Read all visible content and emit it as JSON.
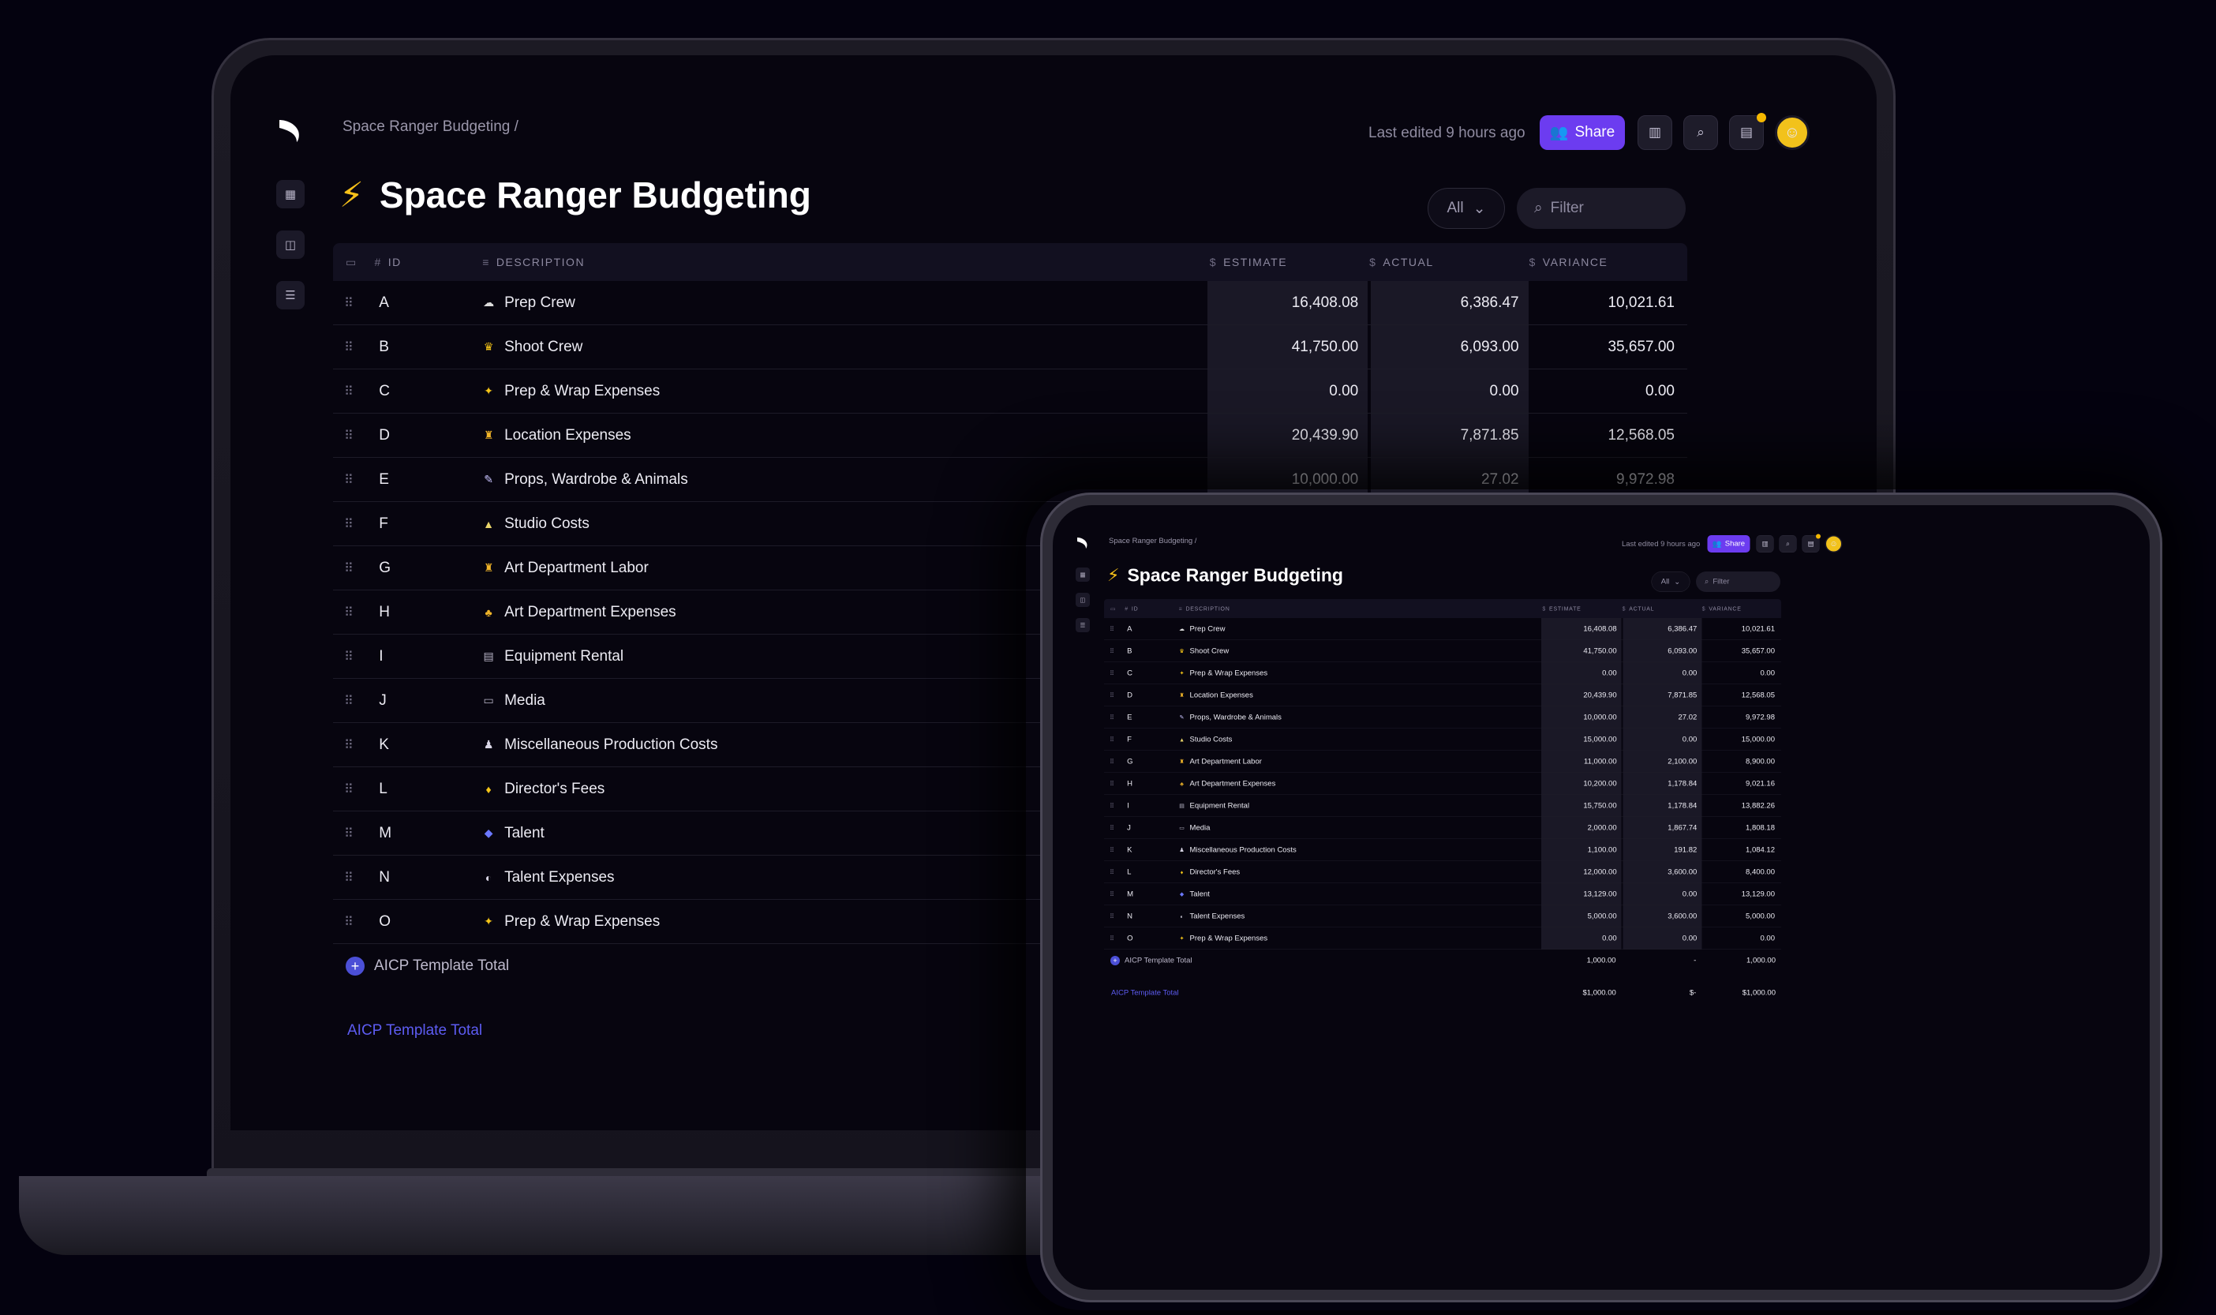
{
  "app": {
    "breadcrumb": "Space Ranger Budgeting /",
    "title": "Space Ranger Budgeting",
    "title_icon": "lightning-bolt",
    "last_edited": "Last edited 9 hours ago",
    "share_label": "Share",
    "filter_select": "All",
    "filter_placeholder": "Filter",
    "accent_color": "#6c3cf0"
  },
  "table": {
    "headers": {
      "id": "ID",
      "description": "DESCRIPTION",
      "estimate": "ESTIMATE",
      "actual": "ACTUAL",
      "variance": "VARIANCE"
    },
    "rows": [
      {
        "id": "A",
        "icon": "☁",
        "description": "Prep Crew",
        "estimate": "16,408.08",
        "actual": "6,386.47",
        "variance": "10,021.61"
      },
      {
        "id": "B",
        "icon": "♛",
        "description": "Shoot Crew",
        "estimate": "41,750.00",
        "actual": "6,093.00",
        "variance": "35,657.00"
      },
      {
        "id": "C",
        "icon": "✦",
        "description": "Prep & Wrap Expenses",
        "estimate": "0.00",
        "actual": "0.00",
        "variance": "0.00"
      },
      {
        "id": "D",
        "icon": "♜",
        "description": "Location Expenses",
        "estimate": "20,439.90",
        "actual": "7,871.85",
        "variance": "12,568.05"
      },
      {
        "id": "E",
        "icon": "✎",
        "description": "Props, Wardrobe & Animals",
        "estimate": "10,000.00",
        "actual": "27.02",
        "variance": "9,972.98"
      },
      {
        "id": "F",
        "icon": "▲",
        "description": "Studio Costs",
        "estimate": "15,000.00",
        "actual": "0.00",
        "variance": "15,000.00"
      },
      {
        "id": "G",
        "icon": "♜",
        "description": "Art Department Labor",
        "estimate": "11,000.00",
        "actual": "2,100.00",
        "variance": "8,900.00"
      },
      {
        "id": "H",
        "icon": "♣",
        "description": "Art Department Expenses",
        "estimate": "10,200.00",
        "actual": "1,178.84",
        "variance": "9,021.16"
      },
      {
        "id": "I",
        "icon": "▤",
        "description": "Equipment Rental",
        "estimate": "15,750.00",
        "actual": "1,178.84",
        "variance": "13,882.26"
      },
      {
        "id": "J",
        "icon": "▭",
        "description": "Media",
        "estimate": "2,000.00",
        "actual": "1,867.74",
        "variance": "1,808.18"
      },
      {
        "id": "K",
        "icon": "♟",
        "description": "Miscellaneous Production Costs",
        "estimate": "1,100.00",
        "actual": "191.82",
        "variance": "1,084.12"
      },
      {
        "id": "L",
        "icon": "♦",
        "description": "Director's Fees",
        "estimate": "12,000.00",
        "actual": "3,600.00",
        "variance": "8,400.00"
      },
      {
        "id": "M",
        "icon": "◆",
        "description": "Talent",
        "estimate": "13,129.00",
        "actual": "0.00",
        "variance": "13,129.00"
      },
      {
        "id": "N",
        "icon": "◐",
        "description": "Talent Expenses",
        "estimate": "5,000.00",
        "actual": "3,600.00",
        "variance": "5,000.00"
      },
      {
        "id": "O",
        "icon": "✦",
        "description": "Prep & Wrap Expenses",
        "estimate": "0.00",
        "actual": "0.00",
        "variance": "0.00"
      }
    ],
    "template_total": {
      "label": "AICP Template Total",
      "estimate": "1,000.00",
      "actual": "-",
      "variance": "1,000.00"
    },
    "grand_total": {
      "label": "AICP Template Total",
      "estimate": "$1,000.00",
      "actual": "$-",
      "variance": "$1,000.00"
    }
  }
}
